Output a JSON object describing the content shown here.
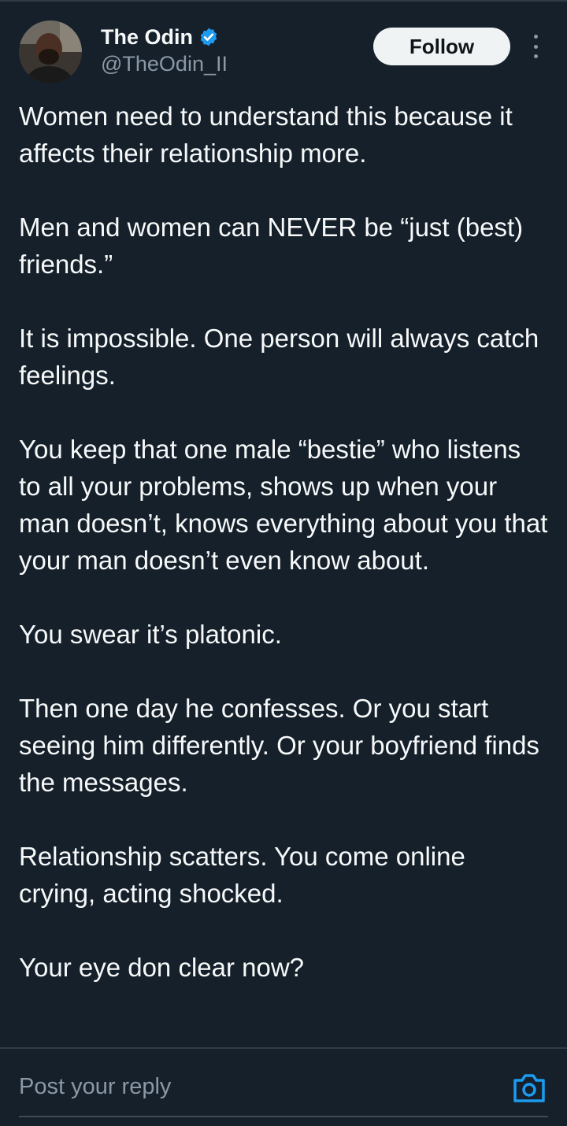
{
  "author": {
    "display_name": "The Odin",
    "handle": "@TheOdin_II",
    "verified_icon": "verified-badge-icon",
    "avatar_icon": "avatar-photo"
  },
  "actions": {
    "follow_label": "Follow",
    "more_icon": "more-vertical-icon"
  },
  "tweet": {
    "paragraphs": [
      "Women need to understand this because it affects their relationship more.",
      "Men and women can NEVER be “just (best) friends.”",
      "It is impossible. One person will always catch feelings.",
      "You keep that one male “bestie” who listens to all your problems, shows up when your man doesn’t, knows everything about you that your man doesn’t even know about.",
      "You swear it’s platonic.",
      "Then one day he confesses. Or you start seeing him differently. Or your boyfriend finds the messages.",
      "Relationship scatters. You come online crying, acting shocked.",
      "Your eye don clear now?"
    ]
  },
  "reply": {
    "placeholder": "Post your reply",
    "camera_icon": "camera-icon"
  },
  "colors": {
    "background": "#15202b",
    "text": "#f7f9f9",
    "secondary_text": "#8b98a5",
    "accent": "#1d9bf0",
    "follow_button": "#eff3f4"
  }
}
